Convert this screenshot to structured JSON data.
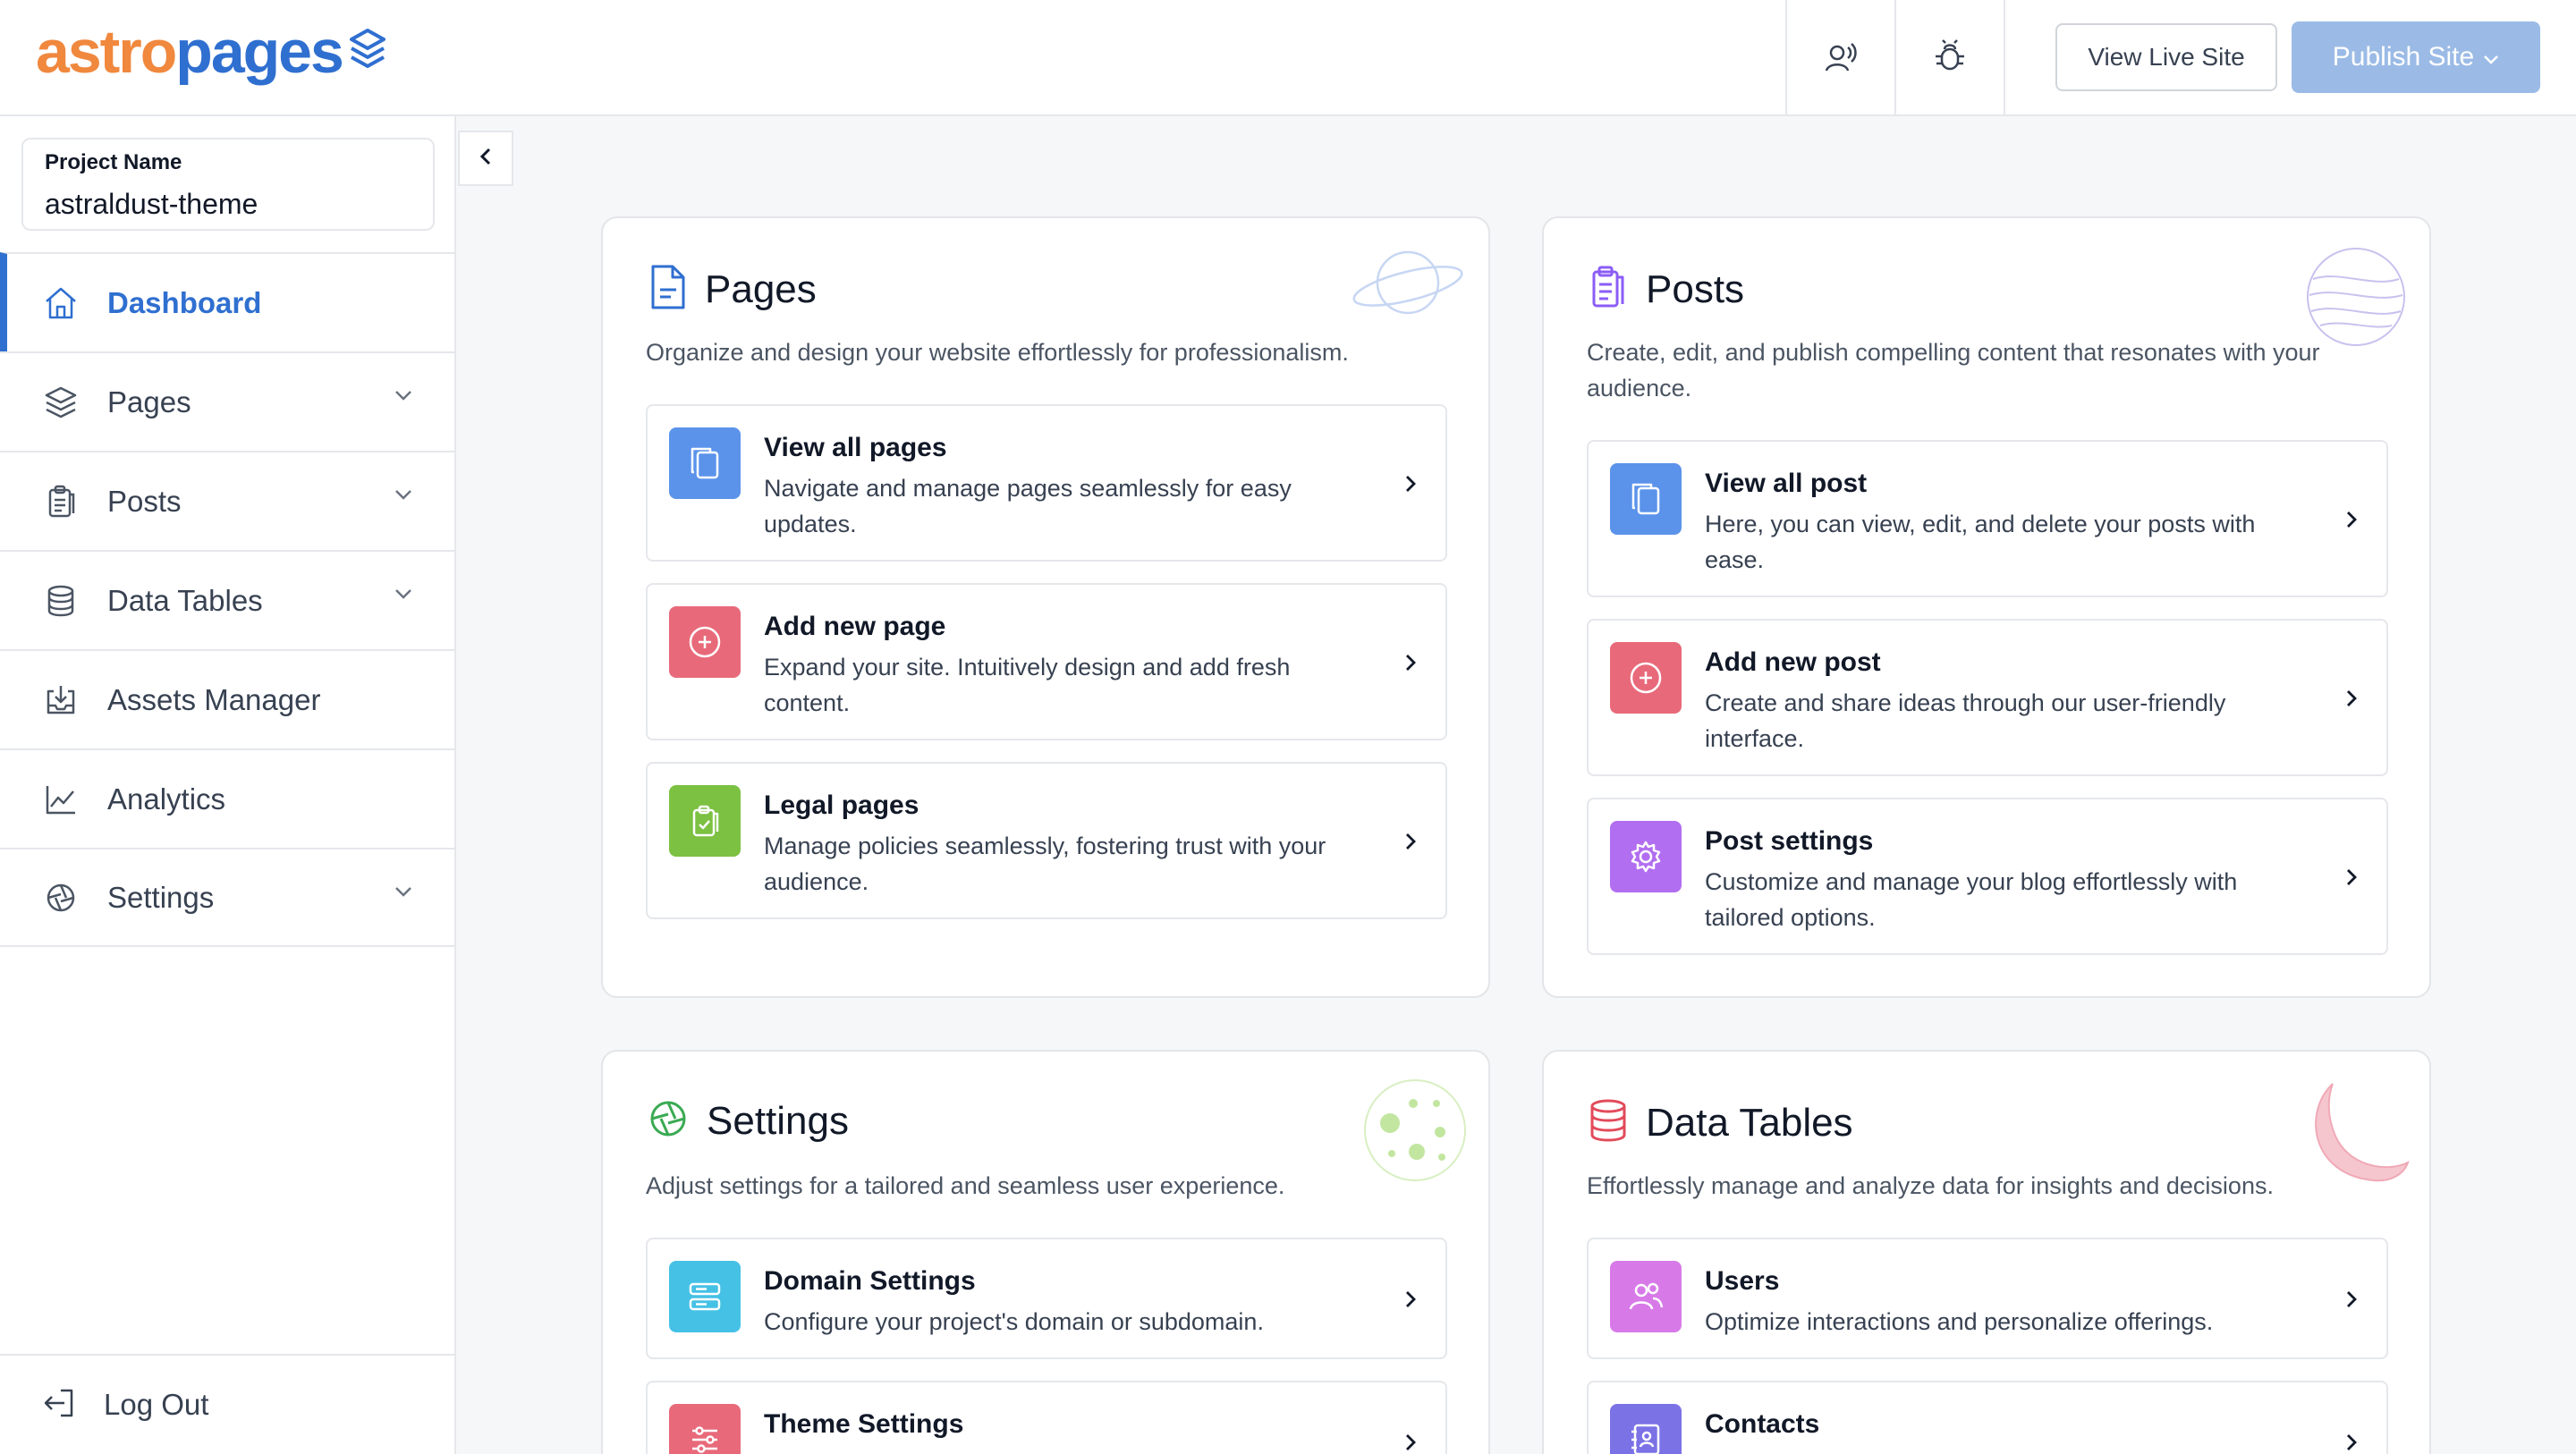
{
  "header": {
    "logo_part1": "astro",
    "logo_part2": "pages",
    "view_live_label": "View Live Site",
    "publish_label": "Publish Site"
  },
  "sidebar": {
    "project_label": "Project Name",
    "project_value": "astraldust-theme",
    "items": [
      {
        "label": "Dashboard"
      },
      {
        "label": "Pages"
      },
      {
        "label": "Posts"
      },
      {
        "label": "Data Tables"
      },
      {
        "label": "Assets Manager"
      },
      {
        "label": "Analytics"
      },
      {
        "label": "Settings"
      }
    ],
    "logout_label": "Log Out"
  },
  "cards": {
    "pages": {
      "title": "Pages",
      "desc": "Organize and design your website effortlessly for professionalism.",
      "items": [
        {
          "title": "View all pages",
          "desc": "Navigate and manage pages seamlessly for easy updates."
        },
        {
          "title": "Add new page",
          "desc": "Expand your site. Intuitively design and add fresh content."
        },
        {
          "title": "Legal pages",
          "desc": "Manage policies seamlessly, fostering trust with your audience."
        }
      ]
    },
    "posts": {
      "title": "Posts",
      "desc": "Create, edit, and publish compelling content that resonates with your audience.",
      "items": [
        {
          "title": "View all post",
          "desc": "Here, you can view, edit, and delete your posts with ease."
        },
        {
          "title": "Add new post",
          "desc": "Create and share ideas through our user-friendly interface."
        },
        {
          "title": "Post settings",
          "desc": "Customize and manage your blog effortlessly with tailored options."
        }
      ]
    },
    "settings": {
      "title": "Settings",
      "desc": "Adjust settings for a tailored and seamless user experience.",
      "items": [
        {
          "title": "Domain Settings",
          "desc": "Configure your project's domain or subdomain."
        },
        {
          "title": "Theme Settings",
          "desc": ""
        }
      ]
    },
    "data_tables": {
      "title": "Data Tables",
      "desc": "Effortlessly manage and analyze data for insights and decisions.",
      "items": [
        {
          "title": "Users",
          "desc": "Optimize interactions and personalize offerings."
        },
        {
          "title": "Contacts",
          "desc": ""
        }
      ]
    }
  },
  "colors": {
    "accent": "#2f6fd0",
    "logo_orange": "#f0883e",
    "publish_bg": "#9bbbe6",
    "tile_blue": "#5b93ea",
    "tile_red": "#e86a7a",
    "tile_green": "#7cc142",
    "tile_purple": "#b26ef0",
    "tile_cyan": "#46c1e6",
    "tile_indigo": "#7b72e6"
  }
}
